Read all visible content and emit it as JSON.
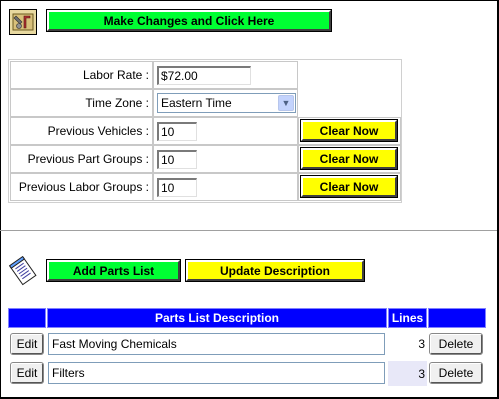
{
  "toolbar": {
    "tools_icon": "tools-icon",
    "make_changes_label": "Make Changes and Click Here"
  },
  "settings": {
    "labor_rate": {
      "label": "Labor Rate :",
      "value": "$72.00"
    },
    "time_zone": {
      "label": "Time Zone :",
      "selected": "Eastern Time"
    },
    "previous_vehicles": {
      "label": "Previous Vehicles :",
      "value": "10",
      "button": "Clear Now"
    },
    "previous_part_groups": {
      "label": "Previous Part Groups :",
      "value": "10",
      "button": "Clear Now"
    },
    "previous_labor_groups": {
      "label": "Previous Labor Groups :",
      "value": "10",
      "button": "Clear Now"
    }
  },
  "parts": {
    "notepad_icon": "notepad-icon",
    "add_label": "Add Parts List",
    "update_label": "Update Description",
    "headers": {
      "description": "Parts List Description",
      "lines": "Lines"
    },
    "rows": [
      {
        "edit": "Edit",
        "description": "Fast Moving Chemicals",
        "lines": "3",
        "delete": "Delete"
      },
      {
        "edit": "Edit",
        "description": "Filters",
        "lines": "3",
        "delete": "Delete"
      }
    ]
  },
  "colors": {
    "green_button": "#00ff33",
    "yellow_button": "#ffff00",
    "header_blue": "#0000ff",
    "lines_highlight": "#e8e8f8"
  }
}
